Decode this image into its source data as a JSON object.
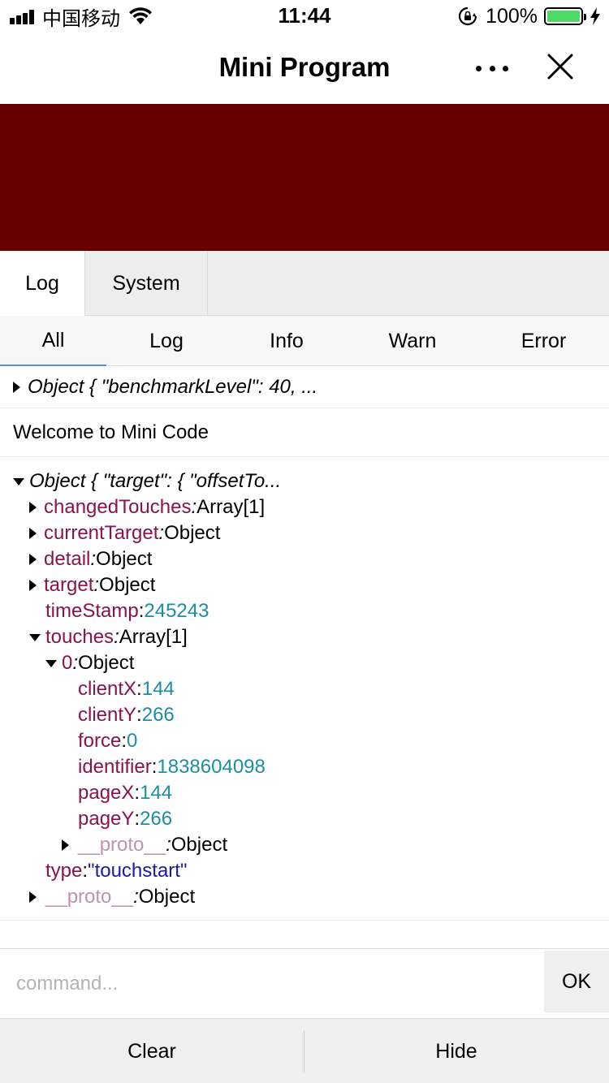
{
  "status_bar": {
    "carrier": "中国移动",
    "time": "11:44",
    "battery_percent": "100%",
    "battery_level": 1.0,
    "battery_color": "#4cd964"
  },
  "nav": {
    "title": "Mini Program"
  },
  "banner": {
    "color": "#660000"
  },
  "console": {
    "main_tabs": [
      "Log",
      "System"
    ],
    "filter_tabs": [
      "All",
      "Log",
      "Info",
      "Warn",
      "Error"
    ],
    "logs": {
      "first_object": "Object { \"benchmarkLevel\": 40, ...",
      "welcome": "Welcome to Mini Code",
      "tree_root": "Object { \"target\": { \"offsetTo...",
      "tree": [
        {
          "key": "changedTouches",
          "sep": ":",
          "value": " Array[1]"
        },
        {
          "key": "currentTarget",
          "sep": ":",
          "value": " Object"
        },
        {
          "key": "detail",
          "sep": ":",
          "value": " Object"
        },
        {
          "key": "target",
          "sep": ":",
          "value": " Object"
        },
        {
          "key": "timeStamp",
          "sep": ": ",
          "value": "245243"
        },
        {
          "key": "touches",
          "sep": ":",
          "value": " Array[1]"
        },
        {
          "key": "0",
          "sep": ":",
          "value": " Object"
        },
        {
          "key": "clientX",
          "sep": ": ",
          "value": "144"
        },
        {
          "key": "clientY",
          "sep": ": ",
          "value": "266"
        },
        {
          "key": "force",
          "sep": ": ",
          "value": "0"
        },
        {
          "key": "identifier",
          "sep": ": ",
          "value": "1838604098"
        },
        {
          "key": "pageX",
          "sep": ": ",
          "value": "144"
        },
        {
          "key": "pageY",
          "sep": ": ",
          "value": "266"
        },
        {
          "key": "__proto__",
          "sep": ":",
          "value": " Object"
        },
        {
          "key": "type",
          "sep": ": ",
          "value": "\"touchstart\""
        },
        {
          "key": "__proto__",
          "sep": ":",
          "value": " Object"
        }
      ]
    },
    "command": {
      "placeholder": "command...",
      "ok_label": "OK"
    },
    "footer": {
      "clear_label": "Clear",
      "hide_label": "Hide"
    }
  }
}
